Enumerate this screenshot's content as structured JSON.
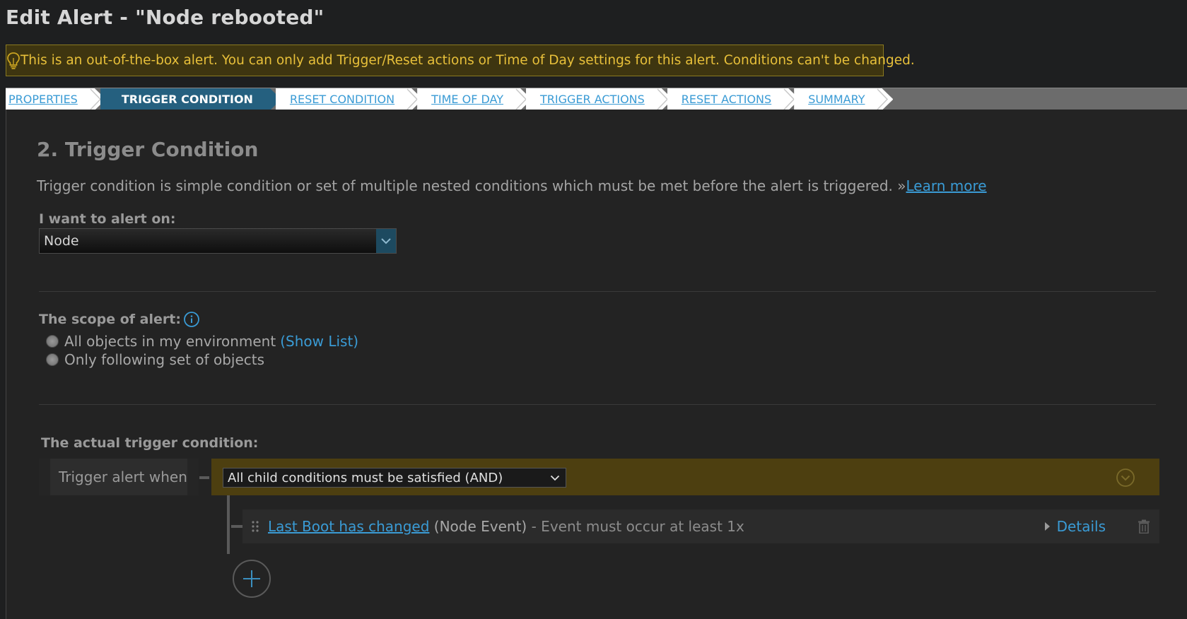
{
  "page": {
    "title": "Edit Alert - \"Node rebooted\""
  },
  "notice": {
    "icon": "lightbulb-icon",
    "text": "This is an out-of-the-box alert. You can only add Trigger/Reset actions or Time of Day settings for this alert. Conditions can't be changed."
  },
  "wizard": {
    "steps": [
      {
        "label": "PROPERTIES",
        "active": false
      },
      {
        "label": "TRIGGER CONDITION",
        "active": true
      },
      {
        "label": "RESET CONDITION",
        "active": false
      },
      {
        "label": "TIME OF DAY",
        "active": false
      },
      {
        "label": "TRIGGER ACTIONS",
        "active": false
      },
      {
        "label": "RESET ACTIONS",
        "active": false
      },
      {
        "label": "SUMMARY",
        "active": false
      }
    ]
  },
  "section": {
    "title": "2. Trigger Condition",
    "description": "Trigger condition is simple condition or set of multiple nested conditions which must be met before the alert is triggered. »",
    "learn_more": "Learn more"
  },
  "alert_on": {
    "label": "I want to alert on:",
    "value": "Node"
  },
  "scope": {
    "label": "The scope of alert:",
    "options": [
      {
        "label": "All objects in my environment",
        "link": "(Show List)"
      },
      {
        "label": "Only following set of objects"
      }
    ]
  },
  "trigger": {
    "label": "The actual trigger condition:",
    "when_label": "Trigger alert when",
    "logic_value": "All child conditions must be satisfied (AND)",
    "condition": {
      "link": "Last Boot has changed",
      "type": "(Node Event)",
      "rule": "- Event must occur at least 1x",
      "details_label": "Details"
    }
  },
  "colors": {
    "accent": "#3a9bd5",
    "warning_bg": "#3e3510",
    "warning_text": "#e8c03a",
    "active_step": "#25607f",
    "and_bar": "#4d3f10"
  }
}
